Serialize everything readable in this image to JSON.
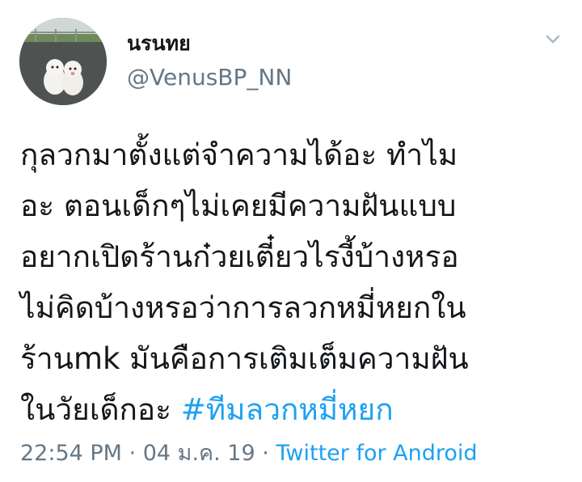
{
  "user": {
    "display_name": "นรนทย",
    "handle": "@VenusBP_NN"
  },
  "tweet": {
    "text": "กุลวกมาตั้งแต่จำความได้อะ ทำไม\nอะ ตอนเด็กๆไม่เคยมีความฝันแบบ\nอยากเปิดร้านก๋วยเตี๋ยวไรงี้บ้างหรอ\nไม่คิดบ้างหรอว่าการลวกหมี่หยกใน\nร้านmk มันคือการเติมเต็มความฝัน\nในวัยเด็กอะ ",
    "hashtag": "#ทีมลวกหมี่หยก"
  },
  "meta": {
    "time": "22:54 PM",
    "sep1": " · ",
    "date": "04 ม.ค. 19",
    "sep2": " · ",
    "source": "Twitter for Android"
  },
  "colors": {
    "text": "#14171a",
    "secondary": "#657786",
    "link": "#1da1f2"
  },
  "icons": {
    "caret": "chevron-down-icon"
  }
}
